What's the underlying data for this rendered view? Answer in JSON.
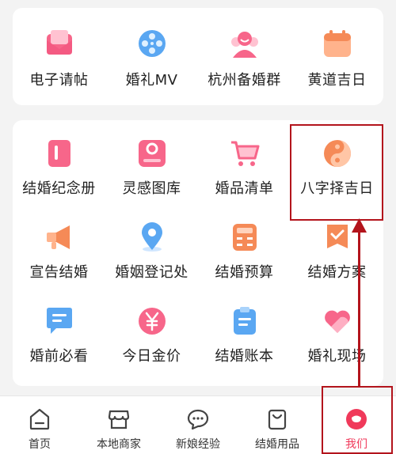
{
  "colors": {
    "pink": "#f7668a",
    "blue": "#5aa7f2",
    "orange": "#f58a57",
    "accent": "#f0395a",
    "highlight": "#b3141c"
  },
  "top_row": [
    {
      "label": "电子请帖",
      "icon": "envelope-icon"
    },
    {
      "label": "婚礼MV",
      "icon": "film-reel-icon"
    },
    {
      "label": "杭州备婚群",
      "icon": "group-chat-icon"
    },
    {
      "label": "黄道吉日",
      "icon": "calendar-icon"
    }
  ],
  "tools": [
    {
      "label": "结婚纪念册",
      "icon": "album-icon"
    },
    {
      "label": "灵感图库",
      "icon": "gallery-icon"
    },
    {
      "label": "婚品清单",
      "icon": "shopping-cart-icon"
    },
    {
      "label": "八字择吉日",
      "icon": "yin-yang-icon"
    },
    {
      "label": "宣告结婚",
      "icon": "megaphone-icon"
    },
    {
      "label": "婚姻登记处",
      "icon": "location-pin-icon"
    },
    {
      "label": "结婚预算",
      "icon": "calculator-icon"
    },
    {
      "label": "结婚方案",
      "icon": "ribbon-badge-icon"
    },
    {
      "label": "婚前必看",
      "icon": "message-icon"
    },
    {
      "label": "今日金价",
      "icon": "yuan-coin-icon"
    },
    {
      "label": "结婚账本",
      "icon": "clipboard-icon"
    },
    {
      "label": "婚礼现场",
      "icon": "heart-icon"
    }
  ],
  "bottom_nav": [
    {
      "label": "首页",
      "icon": "home-icon",
      "active": false
    },
    {
      "label": "本地商家",
      "icon": "store-icon",
      "active": false
    },
    {
      "label": "新娘经验",
      "icon": "chat-bubble-icon",
      "active": false
    },
    {
      "label": "结婚用品",
      "icon": "shopping-bag-icon",
      "active": false
    },
    {
      "label": "我们",
      "icon": "profile-icon",
      "active": true
    }
  ]
}
